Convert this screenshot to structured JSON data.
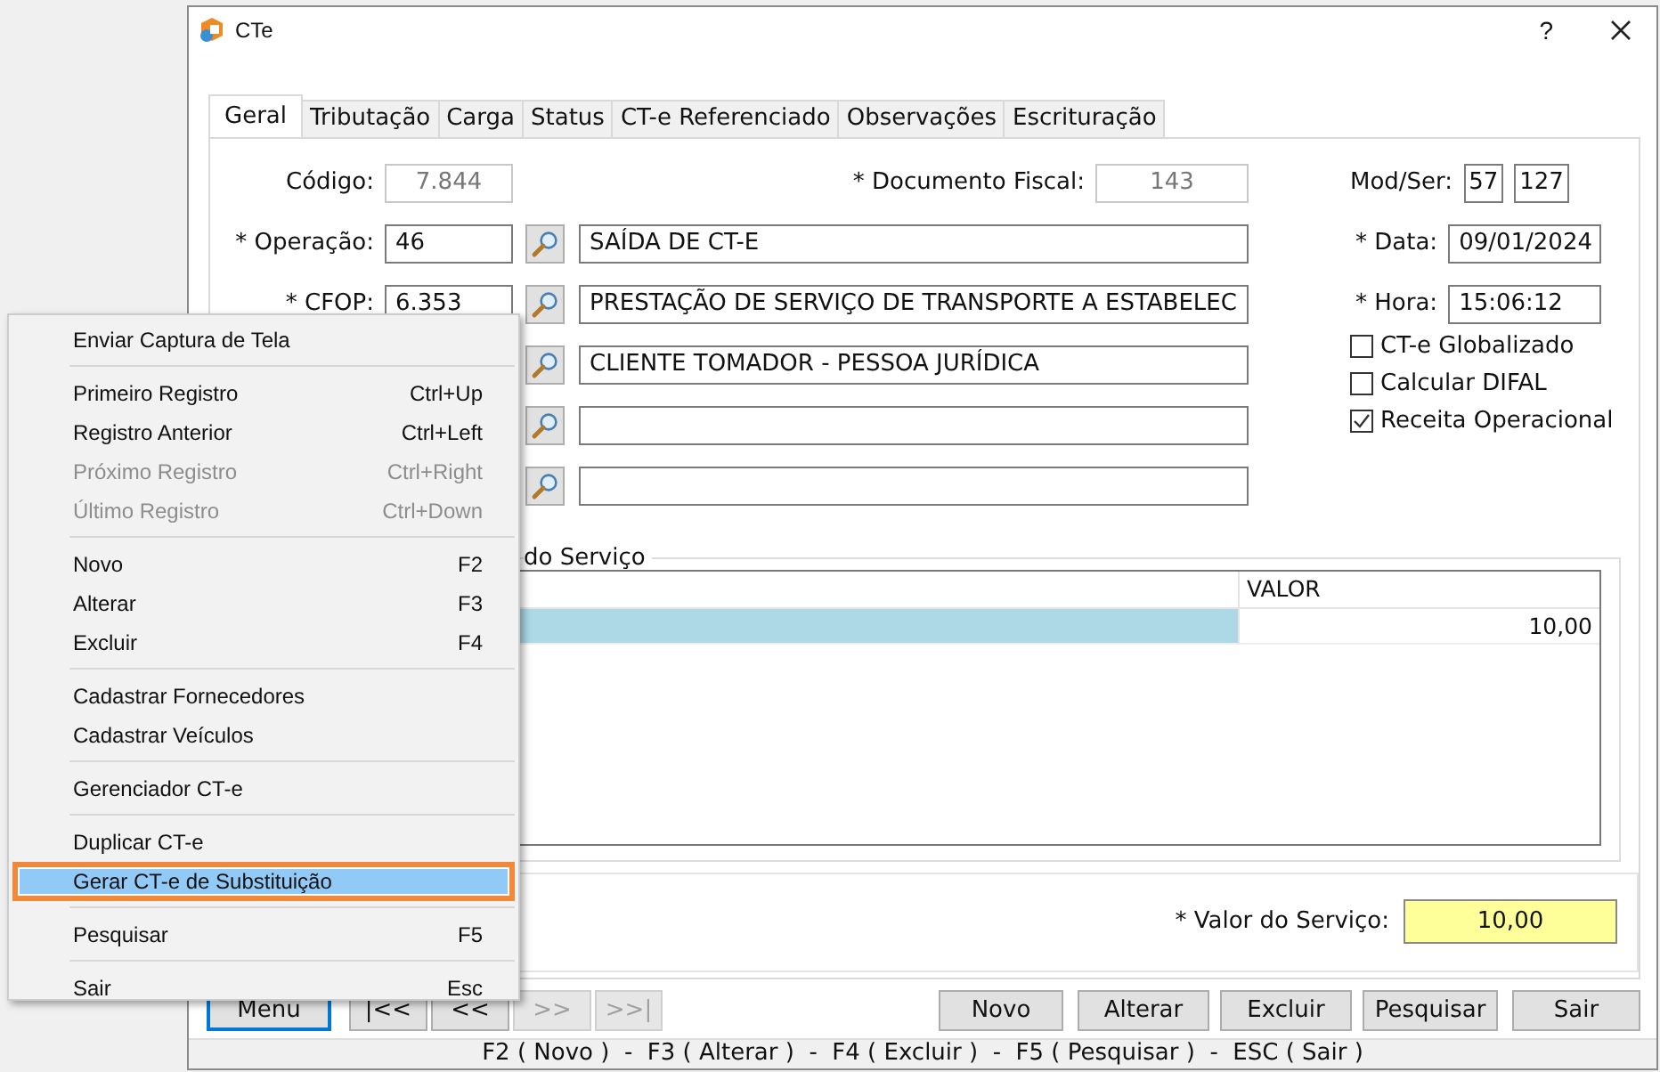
{
  "window": {
    "title": "CTe",
    "help": "?"
  },
  "tabs": [
    {
      "label": "Geral",
      "selected": true
    },
    {
      "label": "Tributação",
      "selected": false
    },
    {
      "label": "Carga",
      "selected": false
    },
    {
      "label": "Status",
      "selected": false
    },
    {
      "label": "CT-e Referenciado",
      "selected": false
    },
    {
      "label": "Observações",
      "selected": false
    },
    {
      "label": "Escrituração",
      "selected": false
    }
  ],
  "codigo": {
    "label": "Código:",
    "value": "7.844"
  },
  "documento_fiscal": {
    "label": "* Documento Fiscal:",
    "value": "143"
  },
  "lookup_rows": [
    {
      "label": "* Operação:",
      "code": "46",
      "description": "SAÍDA DE CT-E"
    },
    {
      "label": "* CFOP:",
      "code": "6.353",
      "description": "PRESTAÇÃO DE SERVIÇO DE TRANSPORTE A ESTABELEC"
    },
    {
      "description": "CLIENTE TOMADOR - PESSOA JURÍDICA"
    },
    {},
    {}
  ],
  "mod_ser": {
    "label": "Mod/Ser:",
    "mod": "57",
    "ser": "127"
  },
  "data": {
    "label": "* Data:",
    "value": "09/01/2024"
  },
  "hora": {
    "label": "* Hora:",
    "value": "15:06:12"
  },
  "checkboxes": [
    {
      "label": "CT-e Globalizado",
      "checked": false
    },
    {
      "label": "Calcular DIFAL",
      "checked": false
    },
    {
      "label": "Receita Operacional",
      "checked": true
    }
  ],
  "group": {
    "legend": "do Serviço"
  },
  "table": {
    "columns": [
      "VALOR"
    ],
    "rows": [
      {
        "value": "10,00",
        "selected": true
      }
    ]
  },
  "total": {
    "label": "* Valor do Serviço:",
    "value": "10,00"
  },
  "nav_buttons": [
    {
      "label": "Menu",
      "focused": true,
      "disabled": false
    },
    {
      "label": "|<<",
      "focused": false,
      "disabled": false
    },
    {
      "label": "<<",
      "focused": false,
      "disabled": false
    },
    {
      "label": ">>",
      "focused": false,
      "disabled": true
    },
    {
      "label": ">>|",
      "focused": false,
      "disabled": true
    }
  ],
  "action_buttons": [
    "Novo",
    "Alterar",
    "Excluir",
    "Pesquisar",
    "Sair"
  ],
  "status_bar": "F2 ( Novo )  -  F3 ( Alterar )  -  F4 ( Excluir )  -  F5 ( Pesquisar )  -  ESC ( Sair )",
  "context_menu": {
    "items": [
      {
        "kind": "item",
        "label": "Enviar Captura de Tela",
        "disabled": false,
        "selected": false
      },
      {
        "kind": "separator"
      },
      {
        "kind": "item",
        "label": "Primeiro Registro",
        "shortcut": "Ctrl+Up",
        "disabled": false,
        "selected": false
      },
      {
        "kind": "item",
        "label": "Registro Anterior",
        "shortcut": "Ctrl+Left",
        "disabled": false,
        "selected": false
      },
      {
        "kind": "item",
        "label": "Próximo Registro",
        "shortcut": "Ctrl+Right",
        "disabled": true,
        "selected": false
      },
      {
        "kind": "item",
        "label": "Último Registro",
        "shortcut": "Ctrl+Down",
        "disabled": true,
        "selected": false
      },
      {
        "kind": "separator"
      },
      {
        "kind": "item",
        "label": "Novo",
        "shortcut": "F2",
        "disabled": false,
        "selected": false
      },
      {
        "kind": "item",
        "label": "Alterar",
        "shortcut": "F3",
        "disabled": false,
        "selected": false
      },
      {
        "kind": "item",
        "label": "Excluir",
        "shortcut": "F4",
        "disabled": false,
        "selected": false
      },
      {
        "kind": "separator"
      },
      {
        "kind": "item",
        "label": "Cadastrar Fornecedores",
        "disabled": false,
        "selected": false
      },
      {
        "kind": "item",
        "label": "Cadastrar Veículos",
        "disabled": false,
        "selected": false
      },
      {
        "kind": "separator"
      },
      {
        "kind": "item",
        "label": "Gerenciador CT-e",
        "disabled": false,
        "selected": false
      },
      {
        "kind": "separator"
      },
      {
        "kind": "item",
        "label": "Duplicar CT-e",
        "disabled": false,
        "selected": false
      },
      {
        "kind": "item",
        "label": "Gerar CT-e de Substituição",
        "disabled": false,
        "selected": true,
        "outlined": true
      },
      {
        "kind": "separator"
      },
      {
        "kind": "item",
        "label": "Pesquisar",
        "shortcut": "F5",
        "disabled": false,
        "selected": false
      },
      {
        "kind": "separator"
      },
      {
        "kind": "item",
        "label": "Sair",
        "shortcut": "Esc",
        "disabled": false,
        "selected": false
      }
    ]
  }
}
